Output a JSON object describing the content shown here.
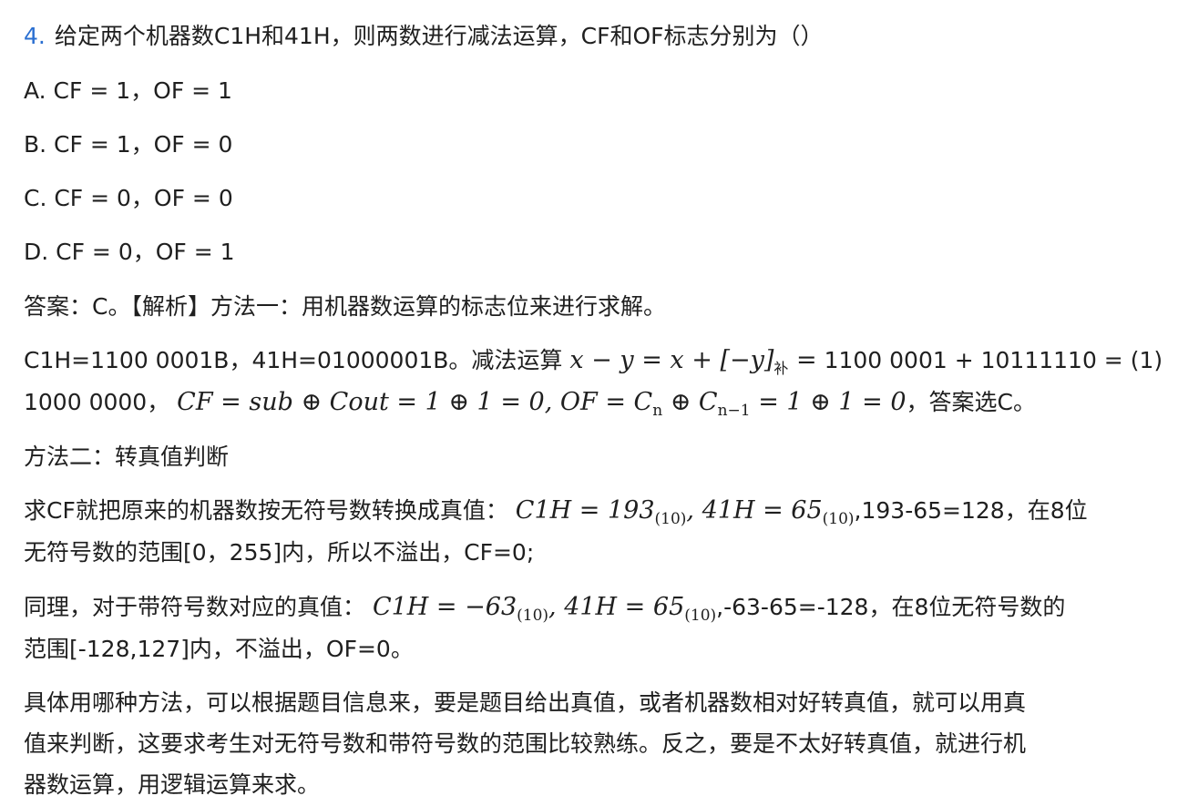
{
  "question": {
    "number": "4.",
    "text": "给定两个机器数C1H和41H，则两数进行减法运算，CF和OF标志分别为（）"
  },
  "options": [
    "A. CF = 1，OF = 1",
    "B. CF = 1，OF = 0",
    "C. CF = 0，OF = 0",
    "D. CF = 0，OF = 1"
  ],
  "analysis": {
    "answer_line": "答案：C。【解析】方法一：用机器数运算的标志位来进行求解。",
    "m1": {
      "l1_text": "C1H=1100 0001B，41H=01000001B。减法运算",
      "l1_math_a": "x − y = x + [−y]",
      "l1_math_sub": "补",
      "l1_math_b": "=",
      "l1_tail": "1100 0001 + 10111110 = (1)",
      "l2_text": "1000 0000，",
      "l2_math": "CF = sub ⊕ Cout = 1 ⊕ 1 = 0, OF = C",
      "l2_sub_n": "n",
      "l2_math_mid": " ⊕ C",
      "l2_sub_n1": "n−1",
      "l2_math_end": " = 1 ⊕ 1 = 0",
      "l2_tail": "，答案选C。"
    },
    "method2_title": "方法二：转真值判断",
    "m2": {
      "p1_text": "求CF就把原来的机器数按无符号数转换成真值：",
      "p1_math_a": "C1H = 193",
      "p1_sub_a": "(10)",
      "p1_math_b": ", 41H = 65",
      "p1_sub_b": "(10)",
      "p1_tail": ",193-65=128，在8位",
      "p1_line2": "无符号数的范围[0，255]内，所以不溢出，CF=0;",
      "p2_text": "同理，对于带符号数对应的真值：",
      "p2_math_a": "C1H = −63",
      "p2_sub_a": "(10)",
      "p2_math_b": ", 41H = 65",
      "p2_sub_b": "(10)",
      "p2_tail": ",-63-65=-128，在8位无符号数的",
      "p2_line2": "范围[-128,127]内，不溢出，OF=0。"
    },
    "summary_lines": [
      "具体用哪种方法，可以根据题目信息来，要是题目给出真值，或者机器数相对好转真值，就可以用真",
      "值来判断，这要求考生对无符号数和带符号数的范围比较熟练。反之，要是不太好转真值，就进行机",
      "器数运算，用逻辑运算来求。"
    ]
  }
}
